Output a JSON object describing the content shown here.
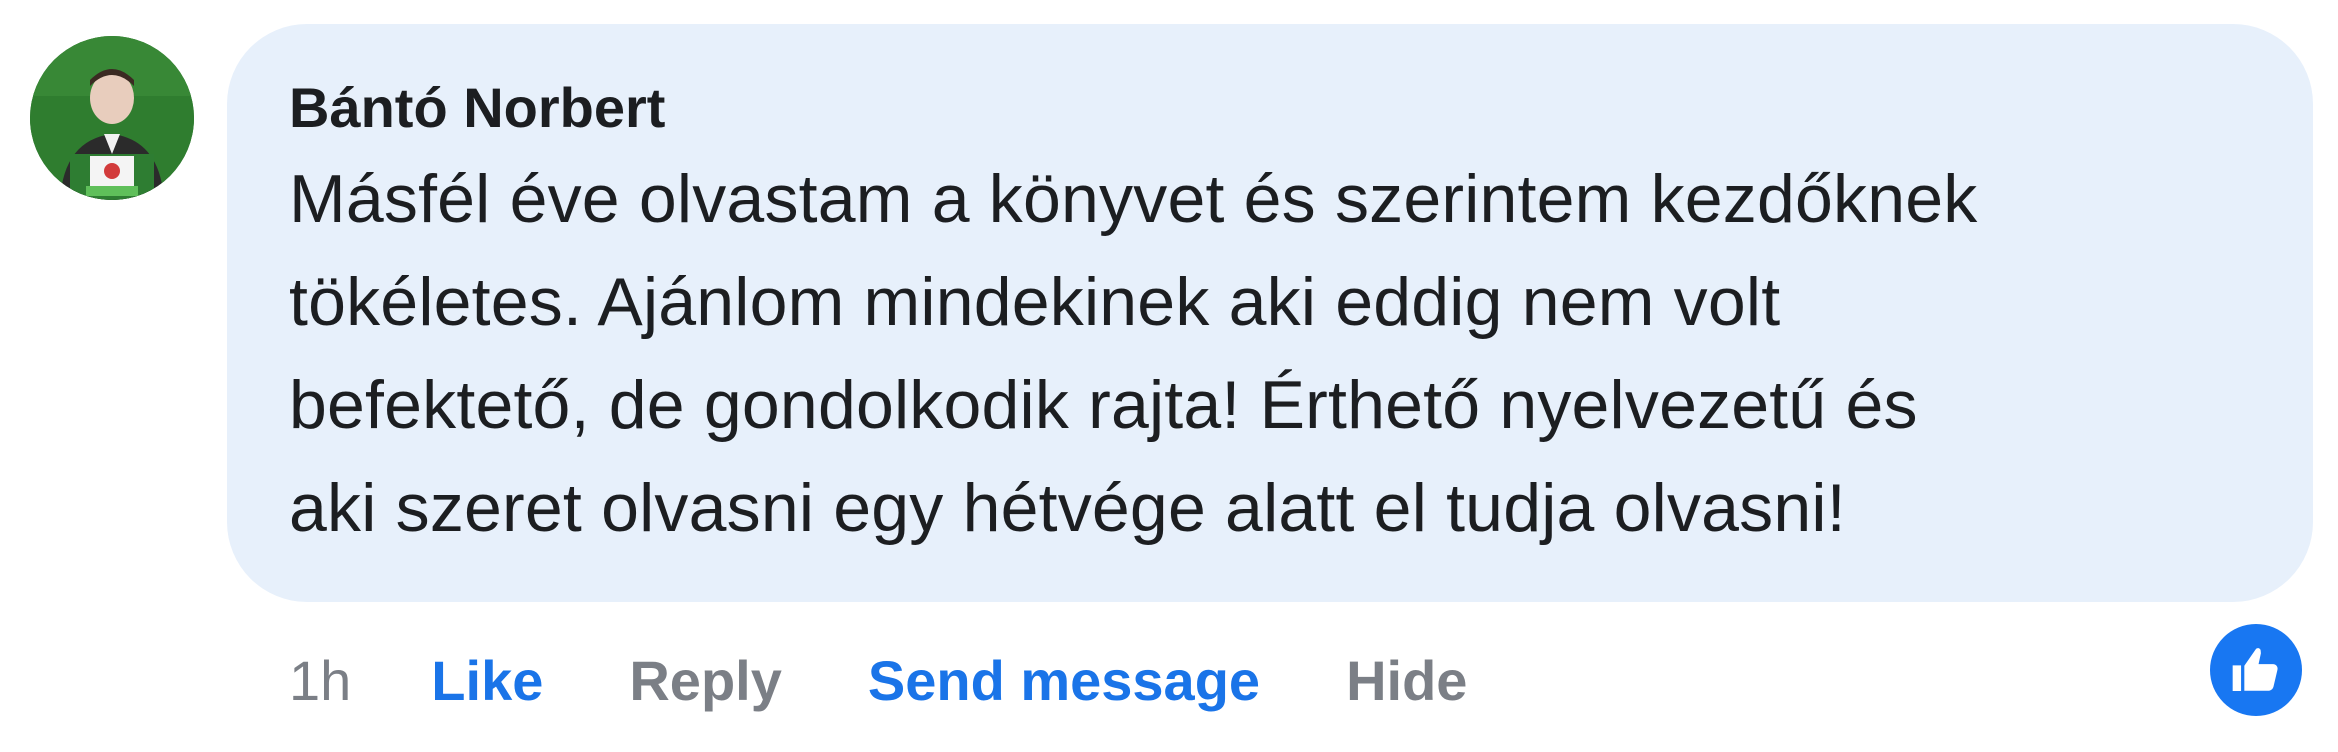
{
  "comment": {
    "author": "Bántó Norbert",
    "text_lines": [
      "Másfél éve olvastam a könyvet és szerintem kezdőknek",
      "tökéletes. Ajánlom mindekinek aki eddig nem volt",
      "befektető, de gondolkodik rajta! Érthető nyelvezetű és",
      "aki szeret olvasni egy hétvége alatt el tudja olvasni!"
    ],
    "timestamp": "1h",
    "actions": {
      "like": "Like",
      "reply": "Reply",
      "send_message": "Send message",
      "hide": "Hide"
    },
    "reaction_icon": "thumbs-up-icon"
  },
  "colors": {
    "bubble_background": "#e7f0fb",
    "link_blue": "#1a74e8",
    "muted_gray": "#7b7f86",
    "reaction_blue": "#1877f2",
    "text": "#1c1e21"
  }
}
